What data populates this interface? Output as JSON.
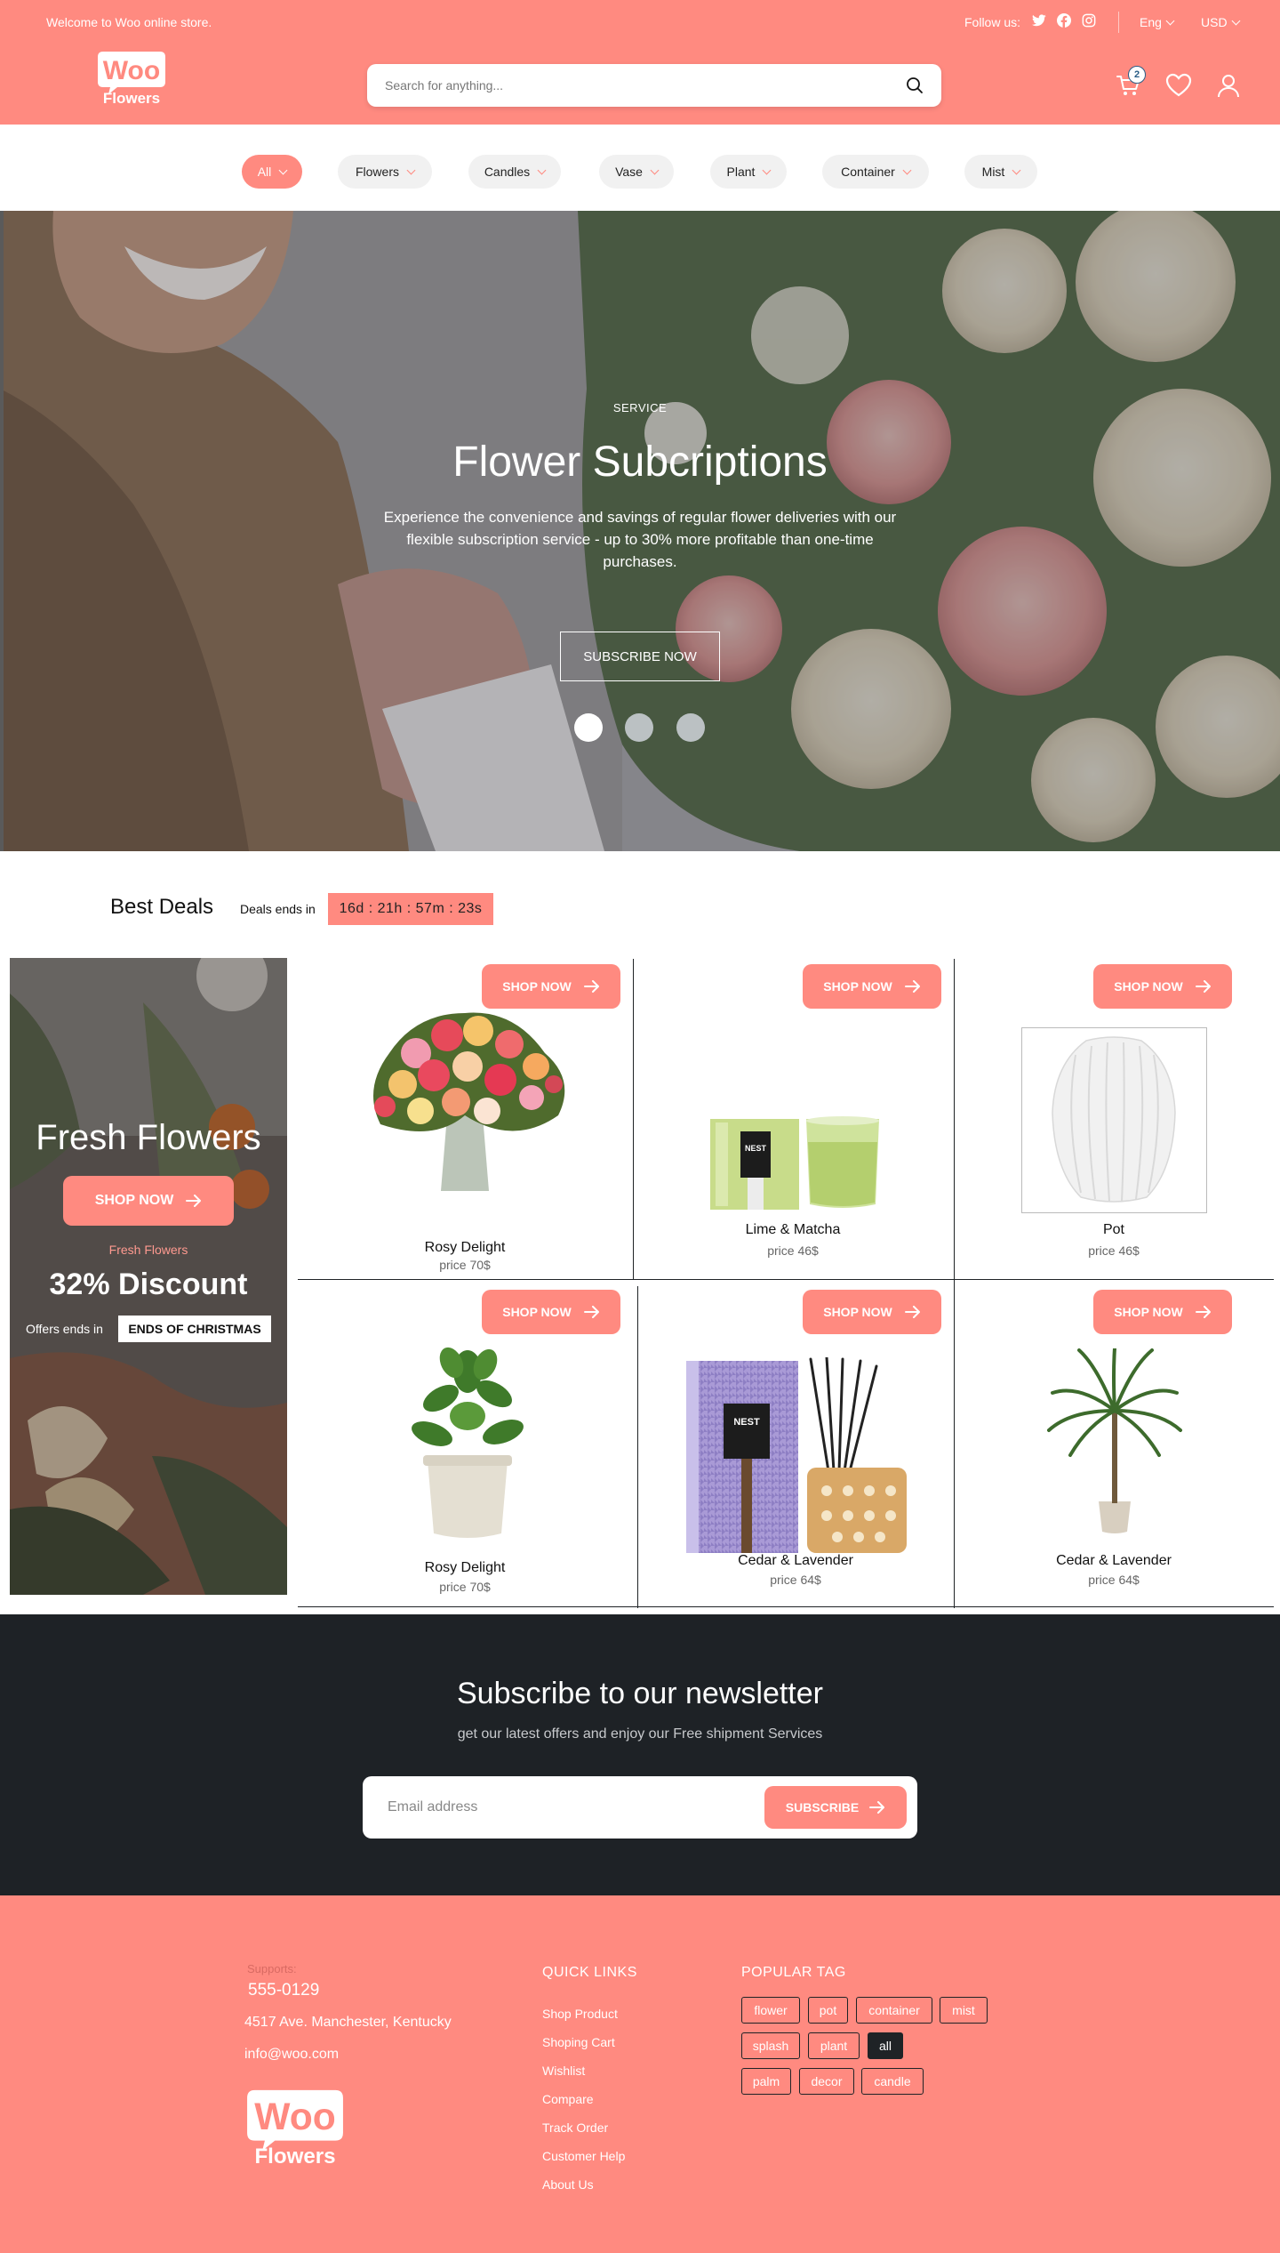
{
  "topbar": {
    "welcome": "Welcome to Woo online  store.",
    "follow_label": "Follow us:",
    "social_icons": [
      "twitter-icon",
      "facebook-icon",
      "instagram-icon"
    ],
    "language": "Eng",
    "currency": "USD"
  },
  "header": {
    "logo_top": "Woo",
    "logo_bottom": "Flowers",
    "search_placeholder": "Search for anything...",
    "cart_count": "2"
  },
  "categories": [
    {
      "label": "All",
      "active": true
    },
    {
      "label": "Flowers",
      "active": false
    },
    {
      "label": "Candles",
      "active": false
    },
    {
      "label": "Vase",
      "active": false
    },
    {
      "label": "Plant",
      "active": false
    },
    {
      "label": "Container",
      "active": false
    },
    {
      "label": "Mist",
      "active": false
    }
  ],
  "hero": {
    "eyebrow": "SERVICE",
    "title": "Flower Subcriptions",
    "description": "Experience the convenience and savings of regular flower deliveries with our flexible subscription service - up to 30% more profitable than one-time purchases.",
    "cta": "SUBSCRIBE NOW",
    "slides": 3,
    "active_slide": 0
  },
  "deals": {
    "title": "Best Deals",
    "ends_label": "Deals ends in",
    "countdown": "16d : 21h : 57m : 23s",
    "promo": {
      "title": "Fresh Flowers",
      "button": "SHOP NOW",
      "subtitle": "Fresh Flowers",
      "discount": "32% Discount",
      "offer_label": "Offers ends in",
      "offer_tag": "ENDS OF CHRISTMAS"
    },
    "products": [
      {
        "name": "Rosy Delight",
        "price": "price 70$",
        "button": "SHOP NOW"
      },
      {
        "name": "Lime & Matcha",
        "price": "price 46$",
        "button": "SHOP NOW",
        "brand": "NEST"
      },
      {
        "name": "Pot",
        "price": "price 46$",
        "button": "SHOP NOW"
      },
      {
        "name": "Rosy Delight",
        "price": "price 70$",
        "button": "SHOP NOW"
      },
      {
        "name": "Cedar & Lavender",
        "price": "price 64$",
        "button": "SHOP NOW",
        "brand": "NEST"
      },
      {
        "name": "Cedar & Lavender",
        "price": "price 64$",
        "button": "SHOP NOW"
      }
    ]
  },
  "newsletter": {
    "title": "Subscribe to our newsletter",
    "subtitle": "get our latest offers and enjoy our Free shipment Services",
    "placeholder": "Email address",
    "button": "SUBSCRIBE"
  },
  "footer": {
    "supports_label": "Supports:",
    "phone": "555-0129",
    "address": "4517  Ave. Manchester, Kentucky",
    "email": "info@woo.com",
    "quick_links_title": "QUICK LINKS",
    "quick_links": [
      "Shop Product",
      "Shoping Cart",
      "Wishlist",
      "Compare",
      "Track Order",
      "Customer Help",
      "About Us"
    ],
    "tags_title": "POPULAR TAG",
    "tags": [
      "flower",
      "pot",
      "container",
      "mist",
      "splash",
      "plant",
      "all",
      "palm",
      "decor",
      "candle"
    ],
    "active_tag": "all"
  },
  "colors": {
    "brand": "#ff8a80",
    "dark": "#1f2326"
  }
}
